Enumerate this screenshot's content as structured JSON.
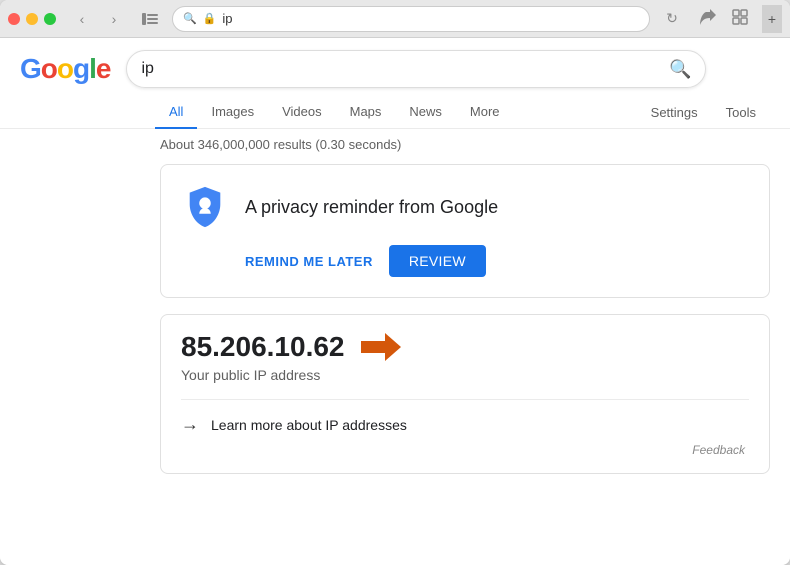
{
  "browser": {
    "traffic_lights": {
      "close": "close",
      "minimize": "minimize",
      "maximize": "maximize"
    },
    "address": {
      "lock_icon": "🔒",
      "url": "ip",
      "prefix": "ip"
    }
  },
  "google": {
    "logo_letters": [
      {
        "char": "G",
        "color_class": "g-blue"
      },
      {
        "char": "o",
        "color_class": "g-red"
      },
      {
        "char": "o",
        "color_class": "g-yellow"
      },
      {
        "char": "g",
        "color_class": "g-blue"
      },
      {
        "char": "l",
        "color_class": "g-green"
      },
      {
        "char": "e",
        "color_class": "g-red"
      }
    ],
    "search_query": "ip",
    "search_icon": "🔍"
  },
  "tabs": {
    "items": [
      {
        "label": "All",
        "active": true
      },
      {
        "label": "Images",
        "active": false
      },
      {
        "label": "Videos",
        "active": false
      },
      {
        "label": "Maps",
        "active": false
      },
      {
        "label": "News",
        "active": false
      },
      {
        "label": "More",
        "active": false
      }
    ],
    "settings_label": "Settings",
    "tools_label": "Tools"
  },
  "results": {
    "count_text": "About 346,000,000 results (0.30 seconds)"
  },
  "privacy_card": {
    "title": "A privacy reminder from Google",
    "remind_later": "REMIND ME LATER",
    "review": "REVIEW"
  },
  "ip_card": {
    "ip_address": "85.206.10.62",
    "label": "Your public IP address",
    "learn_more": "Learn more about IP addresses",
    "feedback": "Feedback"
  }
}
